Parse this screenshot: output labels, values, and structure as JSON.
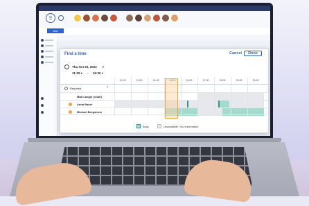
{
  "dialog": {
    "title": "Find a time",
    "cancel_label": "Cancel",
    "done_label": "Done",
    "date": "Thu Oct 20, 2022",
    "start_time": "11:30",
    "end_time": "16:30",
    "time_separator": "–"
  },
  "timeline": {
    "hours": [
      "12:00",
      "13:00",
      "14:00",
      "15:00",
      "16:00",
      "17:00",
      "18:00",
      "19:00",
      "20:00"
    ]
  },
  "attendees": [
    {
      "label": "Required",
      "type": "group"
    },
    {
      "label": "Matt Langer (chair)",
      "type": "person"
    },
    {
      "label": "Anna Bauer",
      "type": "person"
    },
    {
      "label": "Michael Bergstrom",
      "type": "person"
    }
  ],
  "legend": {
    "busy_label": "Busy",
    "unavailable_label": "Unavailable / No information"
  },
  "app": {
    "new_button": "New"
  },
  "colors": {
    "accent": "#2f5fb8",
    "busy": "#a8d9cf",
    "selection": "#f2a73c",
    "unavailable": "#e6e8ec"
  },
  "icons": [
    "clock-icon",
    "person-icon",
    "warning-icon",
    "chevron-down-icon",
    "busy-swatch-icon",
    "unavailable-swatch-icon"
  ]
}
